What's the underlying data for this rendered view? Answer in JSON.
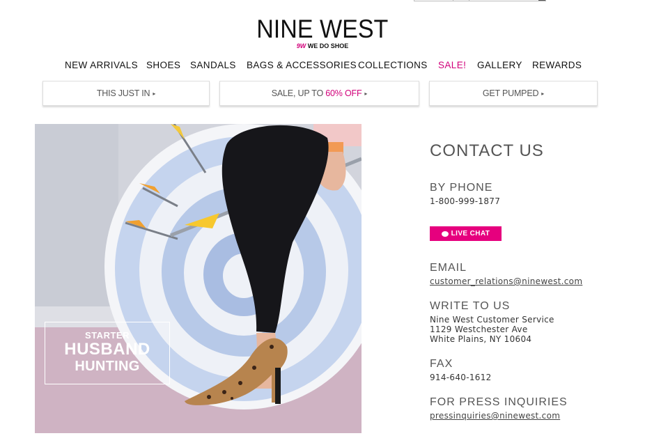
{
  "logo": {
    "brand": "NINE WEST",
    "tagline_mark": "9W",
    "tagline_text": "WE DO SHOE"
  },
  "nav": [
    "NEW ARRIVALS",
    "SHOES",
    "SANDALS",
    "BAGS & ACCESSORIES",
    "COLLECTIONS",
    "SALE!",
    "GALLERY",
    "REWARDS"
  ],
  "promos": {
    "this_just_in": "THIS JUST IN",
    "sale_prefix": "SALE, UP TO ",
    "sale_highlight": "60% OFF",
    "get_pumped": "GET PUMPED",
    "arrow_icon": "▸"
  },
  "hero": {
    "line1": "STARTER",
    "line2": "HUSBAND",
    "line3": "HUNTING"
  },
  "contact": {
    "title": "CONTACT US",
    "phone_heading": "BY PHONE",
    "phone": "1-800-999-1877",
    "live_chat": "LIVE CHAT",
    "email_heading": "EMAIL",
    "email": "customer_relations@ninewest.com",
    "write_heading": "WRITE TO US",
    "address_line1": "Nine West Customer Service",
    "address_line2": "1129 Westchester Ave",
    "address_line3": "White Plains, NY 10604",
    "fax_heading": "FAX",
    "fax": "914-640-1612",
    "press_heading": "FOR PRESS INQUIRIES",
    "press_email": "pressinquiries@ninewest.com"
  },
  "colors": {
    "accent": "#d1007a",
    "chat": "#e6007e",
    "heading": "#555555"
  }
}
